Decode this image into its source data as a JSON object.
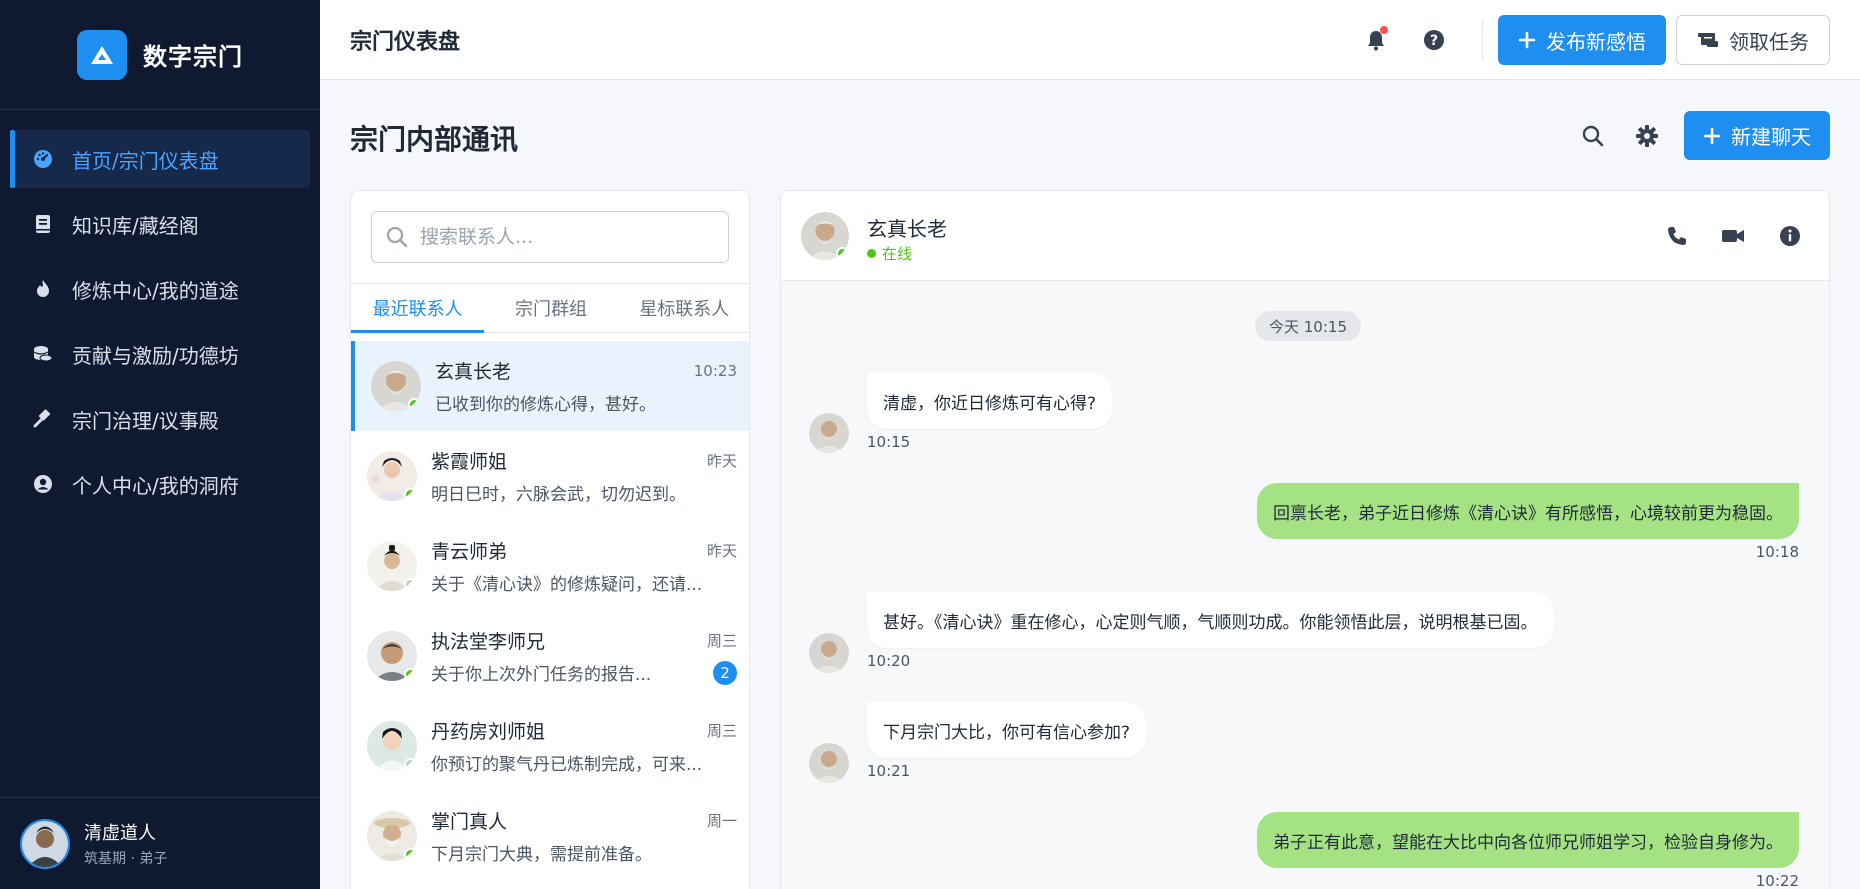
{
  "brand": {
    "name": "数字宗门",
    "accent": "#1f8ef1"
  },
  "sidebar": {
    "items": [
      {
        "label": "首页/宗门仪表盘",
        "icon": "dashboard-gauge-icon",
        "active": true
      },
      {
        "label": "知识库/藏经阁",
        "icon": "book-icon"
      },
      {
        "label": "修炼中心/我的道途",
        "icon": "flame-icon"
      },
      {
        "label": "贡献与激励/功德坊",
        "icon": "coins-icon"
      },
      {
        "label": "宗门治理/议事殿",
        "icon": "gavel-icon"
      },
      {
        "label": "个人中心/我的洞府",
        "icon": "user-circle-icon"
      }
    ],
    "user": {
      "name": "清虚道人",
      "subtitle": "筑基期 · 弟子"
    }
  },
  "header": {
    "title": "宗门仪表盘",
    "publish_label": "发布新感悟",
    "task_label": "领取任务"
  },
  "page": {
    "title": "宗门内部通讯",
    "new_chat_label": "新建聊天"
  },
  "contacts": {
    "search_placeholder": "搜索联系人...",
    "tabs": [
      "最近联系人",
      "宗门群组",
      "星标联系人"
    ],
    "items": [
      {
        "name": "玄真长老",
        "time": "10:23",
        "message": "已收到你的修炼心得，甚好。",
        "online": true,
        "active": true
      },
      {
        "name": "紫霞师姐",
        "time": "昨天",
        "message": "明日巳时，六脉会武，切勿迟到。",
        "online": true
      },
      {
        "name": "青云师弟",
        "time": "昨天",
        "message": "关于《清心诀》的修炼疑问，还请...",
        "online": false
      },
      {
        "name": "执法堂李师兄",
        "time": "周三",
        "message": "关于你上次外门任务的报告...",
        "online": true,
        "badge": "2"
      },
      {
        "name": "丹药房刘师姐",
        "time": "周三",
        "message": "你预订的聚气丹已炼制完成，可来...",
        "online": false
      },
      {
        "name": "掌门真人",
        "time": "周一",
        "message": "下月宗门大典，需提前准备。",
        "online": true
      }
    ]
  },
  "chat": {
    "name": "玄真长老",
    "status": "在线",
    "date_divider": "今天 10:15",
    "messages": [
      {
        "direction": "in",
        "text": "清虚，你近日修炼可有心得?",
        "time": "10:15"
      },
      {
        "direction": "out",
        "text": "回禀长老，弟子近日修炼《清心诀》有所感悟，心境较前更为稳固。",
        "time": "10:18"
      },
      {
        "direction": "in",
        "text": "甚好。《清心诀》重在修心，心定则气顺，气顺则功成。你能领悟此层，说明根基已固。",
        "time": "10:20"
      },
      {
        "direction": "in",
        "text": "下月宗门大比，你可有信心参加?",
        "time": "10:21"
      },
      {
        "direction": "out",
        "text": "弟子正有此意，望能在大比中向各位师兄师姐学习，检验自身修为。",
        "time": "10:22"
      }
    ]
  }
}
